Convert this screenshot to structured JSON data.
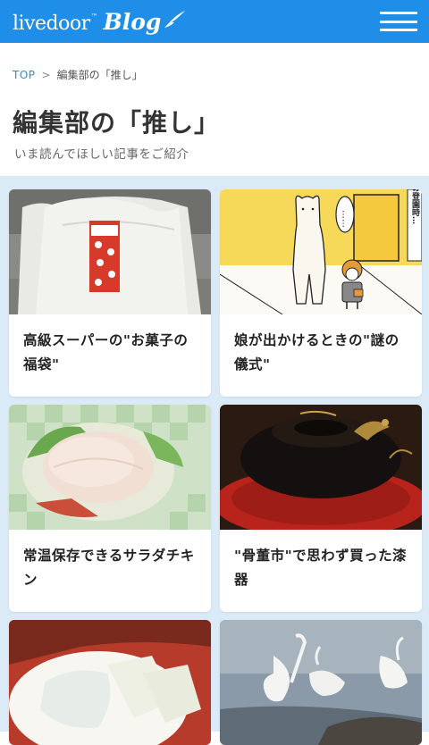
{
  "header": {
    "logo_text": "livedoor",
    "logo_tm": "™",
    "logo_blog": "Blog",
    "menu_icon": "hamburger-menu-icon"
  },
  "breadcrumb": {
    "top": "TOP",
    "separator": ">",
    "current": "編集部の「推し」"
  },
  "page": {
    "title": "編集部の「推し」",
    "subtitle": "いま読んでほしい記事をご紹介"
  },
  "articles": [
    {
      "caption": "高級スーパーの\"お菓子の福袋\""
    },
    {
      "caption": "娘が出かけるときの\"謎の儀式\"",
      "image_text": "朝の登園時…",
      "bubble_text": "……"
    },
    {
      "caption": "常温保存できるサラダチキン"
    },
    {
      "caption": "\"骨董市\"で思わず買った漆器"
    },
    {
      "caption": ""
    },
    {
      "caption": ""
    }
  ],
  "colors": {
    "brand_blue": "#1f8ee8",
    "grid_background": "#dbeaf7"
  }
}
